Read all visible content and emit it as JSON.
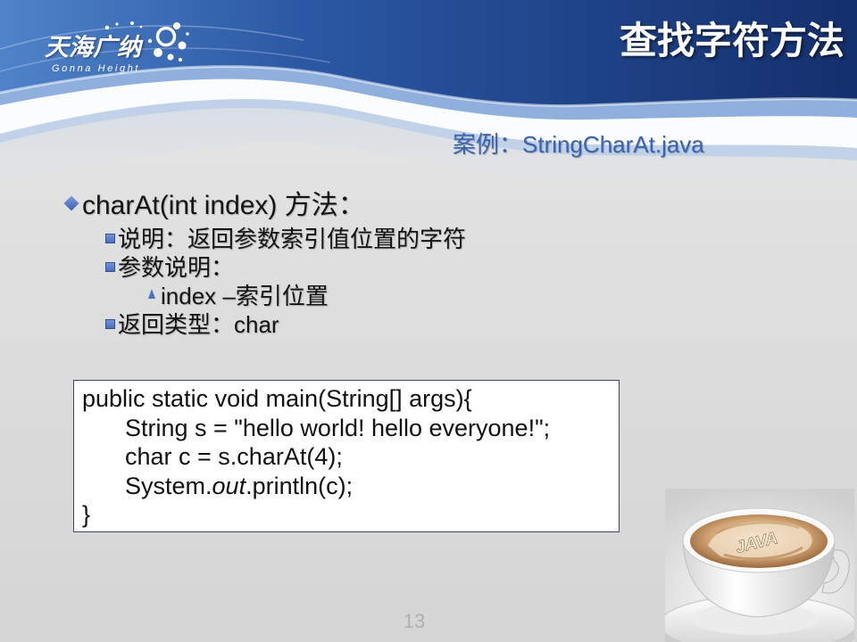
{
  "theme": {
    "accent": "#3a62b0",
    "bullet": "#4a70bf",
    "text": "#141414",
    "page_number": "#b0b0b0",
    "header_dark": "#142f6d",
    "header_light": "#4f83c9"
  },
  "icons": {
    "level1_bullet": "diamond-bullet-icon",
    "level2_bullet": "square-bullet-icon",
    "level3_bullet": "triangle-bullet-icon",
    "logo_mark": "bubbles-icon"
  },
  "logo": {
    "name_cn": "天海广纳",
    "name_en": "Gonna Height"
  },
  "slide": {
    "title": "查找字符方法",
    "subtitle": "案例：StringCharAt.java",
    "page_number": "13"
  },
  "bullets": {
    "method": "charAt(int index) 方法：",
    "description": "说明：返回参数索引值位置的字符",
    "params_heading": "参数说明：",
    "param_index": "index –索引位置",
    "return_type": "返回类型：char"
  },
  "code": {
    "lines": [
      "public static void main(String[] args){",
      "String s = \"hello world! hello everyone!\";",
      "char c = s.charAt(4);",
      {
        "before": "System.",
        "italic": "out",
        "after": ".println(c);"
      },
      "}"
    ]
  },
  "image": {
    "lettering": "JAVA"
  }
}
